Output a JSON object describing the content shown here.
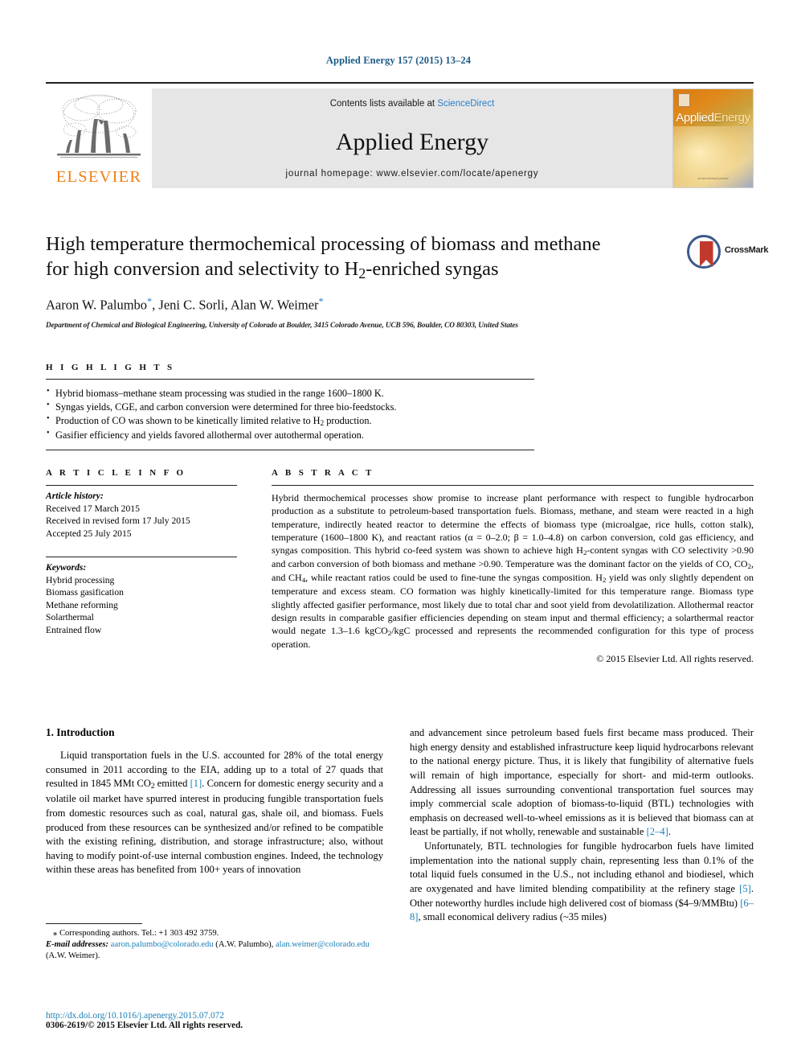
{
  "running_head": "Applied Energy 157 (2015) 13–24",
  "masthead": {
    "contents_prefix": "Contents lists available at ",
    "contents_link": "ScienceDirect",
    "journal_title": "Applied Energy",
    "homepage": "journal homepage: www.elsevier.com/locate/apenergy",
    "publisher_name": "ELSEVIER",
    "cover_name_part1": "Applied",
    "cover_name_part2": "Energy",
    "cover_footer": "an international journal"
  },
  "article": {
    "title_line1": "High temperature thermochemical processing of biomass and methane",
    "title_line2_a": "for high conversion and selectivity to H",
    "title_line2_sub": "2",
    "title_line2_b": "-enriched syngas",
    "crossmark_label": "CrossMark",
    "authors": "Aaron W. Palumbo , Jeni C. Sorli, Alan W. Weimer",
    "author1": "Aaron W. Palumbo",
    "author2": "Jeni C. Sorli",
    "author3": "Alan W. Weimer",
    "affiliation": "Department of Chemical and Biological Engineering, University of Colorado at Boulder, 3415 Colorado Avenue, UCB 596, Boulder, CO 80303, United States"
  },
  "highlights": {
    "heading": "H I G H L I G H T S",
    "items": [
      "Hybrid biomass–methane steam processing was studied in the range 1600–1800 K.",
      "Syngas yields, CGE, and carbon conversion were determined for three bio-feedstocks.",
      "Production of CO was shown to be kinetically limited relative to H2 production.",
      "Gasifier efficiency and yields favored allothermal over autothermal operation."
    ]
  },
  "article_info": {
    "heading": "A R T I C L E     I N F O",
    "history_label": "Article history:",
    "history": [
      "Received 17 March 2015",
      "Received in revised form 17 July 2015",
      "Accepted 25 July 2015"
    ],
    "keywords_label": "Keywords:",
    "keywords": [
      "Hybrid processing",
      "Biomass gasification",
      "Methane reforming",
      "Solarthermal",
      "Entrained flow"
    ]
  },
  "abstract": {
    "heading": "A B S T R A C T",
    "text": "Hybrid thermochemical processes show promise to increase plant performance with respect to fungible hydrocarbon production as a substitute to petroleum-based transportation fuels. Biomass, methane, and steam were reacted in a high temperature, indirectly heated reactor to determine the effects of biomass type (microalgae, rice hulls, cotton stalk), temperature (1600–1800 K), and reactant ratios (α = 0–2.0; β = 1.0–4.8) on carbon conversion, cold gas efficiency, and syngas composition. This hybrid co-feed system was shown to achieve high H2-content syngas with CO selectivity >0.90 and carbon conversion of both biomass and methane >0.90. Temperature was the dominant factor on the yields of CO, CO2, and CH4, while reactant ratios could be used to fine-tune the syngas composition. H2 yield was only slightly dependent on temperature and excess steam. CO formation was highly kinetically-limited for this temperature range. Biomass type slightly affected gasifier performance, most likely due to total char and soot yield from devolatilization. Allothermal reactor design results in comparable gasifier efficiencies depending on steam input and thermal efficiency; a solarthermal reactor would negate 1.3–1.6 kgCO2/kgC processed and represents the recommended configuration for this type of process operation.",
    "rights": "© 2015 Elsevier Ltd. All rights reserved."
  },
  "body": {
    "section_heading": "1. Introduction",
    "left_para1_pre": "Liquid transportation fuels in the U.S. accounted for 28% of the total energy consumed in 2011 according to the EIA, adding up to a total of 27 quads that resulted in 1845 MMt CO",
    "left_para1_sub": "2",
    "left_para1_mid": " emitted ",
    "left_para1_ref": "[1]",
    "left_para1_post": ". Concern for domestic energy security and a volatile oil market have spurred interest in producing fungible transportation fuels from domestic resources such as coal, natural gas, shale oil, and biomass. Fuels produced from these resources can be synthesized and/or refined to be compatible with the existing refining, distribution, and storage infrastructure; also, without having to modify point-of-use internal combustion engines. Indeed, the technology within these areas has benefited from 100+ years of innovation",
    "right_para1_pre": "and advancement since petroleum based fuels first became mass produced. Their high energy density and established infrastructure keep liquid hydrocarbons relevant to the national energy picture. Thus, it is likely that fungibility of alternative fuels will remain of high importance, especially for short- and mid-term outlooks. Addressing all issues surrounding conventional transportation fuel sources may imply commercial scale adoption of biomass-to-liquid (BTL) technologies with emphasis on decreased well-to-wheel emissions as it is believed that biomass can at least be partially, if not wholly, renewable and sustainable ",
    "right_para1_ref": "[2–4]",
    "right_para1_post": ".",
    "right_para2_pre": "Unfortunately, BTL technologies for fungible hydrocarbon fuels have limited implementation into the national supply chain, representing less than 0.1% of the total liquid fuels consumed in the U.S., not including ethanol and biodiesel, which are oxygenated and have limited blending compatibility at the refinery stage ",
    "right_para2_ref1": "[5]",
    "right_para2_mid": ". Other noteworthy hurdles include high delivered cost of biomass ($4–9/MMBtu) ",
    "right_para2_ref2": "[6–8]",
    "right_para2_post": ", small economical delivery radius (~35 miles)"
  },
  "footnotes": {
    "corresponding": "Corresponding authors. Tel.: +1 303 492 3759.",
    "email_label": "E-mail addresses:",
    "email1": "aaron.palumbo@colorado.edu",
    "email1_attr": " (A.W. Palumbo), ",
    "email2": "alan.weimer@colorado.edu",
    "email2_attr": " (A.W. Weimer).",
    "doi": "http://dx.doi.org/10.1016/j.apenergy.2015.07.072",
    "issn": "0306-2619/© 2015 Elsevier Ltd. All rights reserved."
  },
  "colors": {
    "link_blue": "#1a7fb5",
    "head_blue": "#1a5a86",
    "elsevier_orange": "#f07f16",
    "crossmark_red": "#c0392b",
    "crossmark_ring": "#3d5a8a"
  }
}
